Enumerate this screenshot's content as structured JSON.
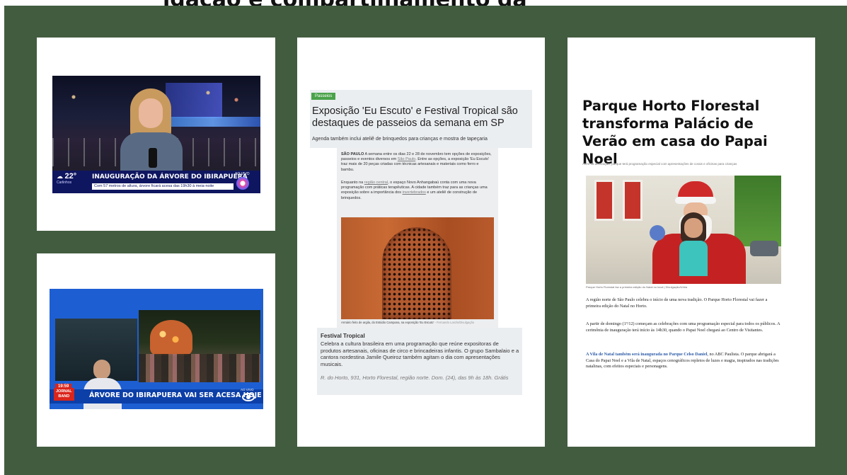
{
  "top_title": "igação e compartilhamento da",
  "tv_globo": {
    "temperature": "22°",
    "city": "Carlinhos",
    "headline": "INAUGURAÇÃO DA ÁRVORE DO IBIRAPUERA",
    "subtitle": "Com 57 metros de altura, árvore ficará acesa das 19h30 à meia-noite",
    "live_label": "AO VIVO"
  },
  "tv_band": {
    "time": "19:59",
    "logo_line1": "JORNAL",
    "logo_line2": "BAND",
    "headline": "ÁRVORE DO IBIRAPUERA VAI SER ACESA HOJE",
    "live_label": "AO VIVO"
  },
  "article1": {
    "tag": "Passeios",
    "title": "Exposição 'Eu Escuto' e Festival Tropical são destaques de passeios da semana em SP",
    "subtitle": "Agenda também inclui ateliê de brinquedos para crianças e mostra de tapeçaria",
    "p1_lead": "SÃO PAULO",
    "p1_a": "A semana entre os dias 22 e 28 de novembro tem opções de exposições, passeios e eventos diversos em ",
    "p1_link": "São Paulo",
    "p1_b": ". Entre as opções, a exposição 'Eu Escuto' traz mais de 20 peças criadas com técnicas artesanais e materiais como ferro e bambu.",
    "p2_a": "Enquanto na ",
    "p2_link1": "região central",
    "p2_b": ", o espaço Novo Anhangabaú conta com uma nova programação com práticas terapêuticas. A cidade também traz para as crianças uma exposição sobre a importância dos ",
    "p2_link2": "invertebrados",
    "p2_c": " e um ateliê de construção de brinquedos.",
    "caption": "Armário feito de argila, do Estúdio Campana, na exposição 'Eu Escuto'",
    "caption_credit": "- Fernando Laszlo/Divulgação",
    "festival_title": "Festival Tropical",
    "festival_body": "Celebra a cultura brasileira em uma programação que reúne expositoras de produtos artesanais, oficinas de circo e brincadeiras infantis. O grupo Sambalaio e a cantora nordestina Jamile Queiroz também agitam o dia com apresentações musicais.",
    "festival_address": "R. do Horto, 931, Horto Florestal, região norte. Dom. (24), das 9h às 18h. Grátis"
  },
  "article2": {
    "title": "Parque Horto Florestal transforma Palácio de Verão em casa do Papai Noel",
    "subtitle": "Além da decoração, parque terá programação especial com apresentações de corais e oficinas para crianças",
    "caption": "Parque Horto Florestal faz a primeira edição do Natal no local | Divulgação/Urbia",
    "p1": "A região norte de São Paulo celebra o início de uma nova tradição. O Parque Horto Florestal vai fazer a primeira edição do Natal no Horto.",
    "p2": "A partir de domingo (1º/12) começam as celebrações com uma programação especial para todos os públicos. A cerimônia de inauguração terá início às 14h30, quando o Papai Noel chegará ao Centro de Visitantes.",
    "p3_link": "A Vila de Natal também será inaugurada no Parque Celso Daniel",
    "p3_b": ", no ABC Paulista. O parque abrigará a Casa do Papai Noel e a Vila de Natal, espaços cenográficos repletos de luzes e magia, inspirados nas tradições natalinas, com efeitos especiais e personagens."
  }
}
